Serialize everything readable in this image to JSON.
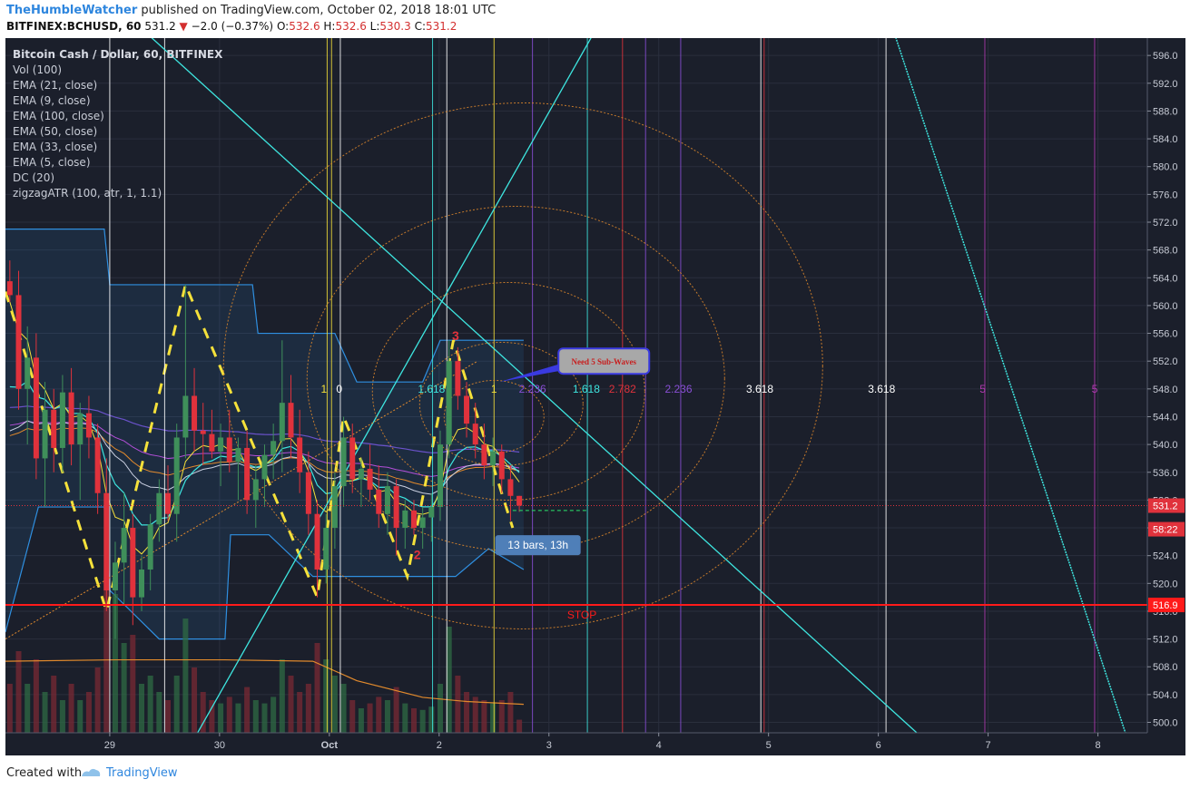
{
  "header": {
    "author": "TheHumbleWatcher",
    "published_text": "published on TradingView.com, October 02, 2018 18:01 UTC",
    "symbol_line": "BITFINEX:BCHUSD, 60",
    "last_price": "531.2",
    "change_arrow": "▼",
    "change_text": "−2.0 (−0.37%)",
    "o_label": "O:",
    "o_value": "532.6",
    "h_label": "H:",
    "h_value": "532.6",
    "l_label": "L:",
    "l_value": "530.3",
    "c_label": "C:",
    "c_value": "531.2"
  },
  "legend": {
    "title": "Bitcoin Cash / Dollar, 60, BITFINEX",
    "studies": [
      "Vol (100)",
      "EMA (21, close)",
      "EMA (9, close)",
      "EMA (100, close)",
      "EMA (50, close)",
      "EMA (33, close)",
      "EMA (5, close)",
      "DC (20)",
      "zigzagATR (100, atr, 1, 1.1)"
    ]
  },
  "footer": {
    "created_with": "Created with",
    "brand": "TradingView"
  },
  "colors": {
    "background": "#1b1f2b",
    "up": "#3f8f5a",
    "down": "#e0323c",
    "stop": "#ff1a1a",
    "cyan": "#3ee6e0",
    "yellow": "#f5e13a",
    "orange": "#e28a2c",
    "purple": "#8a4fd6",
    "blue": "#2f8fe0",
    "white": "#ffffff"
  },
  "chart_data": {
    "type": "candlestick",
    "symbol": "BITFINEX:BCHUSD",
    "interval": "60",
    "x_labels": [
      "29",
      "30",
      "Oct",
      "2",
      "3",
      "4",
      "5",
      "6",
      "7",
      "8"
    ],
    "x_ticks": [
      28.95,
      29.95,
      30.95,
      31.95,
      32.95,
      33.95,
      34.95,
      35.95,
      36.95,
      37.95
    ],
    "xlim": [
      28.0,
      38.4
    ],
    "ylim": [
      498.5,
      598.5
    ],
    "y_ticks": [
      500,
      504,
      508,
      512,
      516,
      520,
      524,
      528,
      532,
      536,
      540,
      544,
      548,
      552,
      556,
      560,
      564,
      568,
      572,
      576,
      580,
      584,
      588,
      592,
      596
    ],
    "price_tags": [
      {
        "text": "531.2",
        "value": 531.2,
        "color": "#e0323c"
      },
      {
        "text": "58:22",
        "value": 527.8,
        "color": "#e0323c"
      },
      {
        "text": "516.9",
        "value": 516.9,
        "color": "#ff1a1a"
      }
    ],
    "stop_level": 516.9,
    "stop_label": "STOP",
    "candles": [
      {
        "x": 28.04,
        "o": 563.5,
        "h": 566.5,
        "l": 560.5,
        "c": 561.5
      },
      {
        "x": 28.12,
        "o": 561.5,
        "h": 565.0,
        "l": 545.0,
        "c": 548.0
      },
      {
        "x": 28.2,
        "o": 548.0,
        "h": 557.0,
        "l": 540.0,
        "c": 552.5
      },
      {
        "x": 28.28,
        "o": 552.5,
        "h": 556.0,
        "l": 535.0,
        "c": 538.0
      },
      {
        "x": 28.36,
        "o": 538.0,
        "h": 549.0,
        "l": 531.0,
        "c": 545.0
      },
      {
        "x": 28.44,
        "o": 545.0,
        "h": 548.0,
        "l": 536.0,
        "c": 539.5
      },
      {
        "x": 28.52,
        "o": 539.5,
        "h": 550.0,
        "l": 536.0,
        "c": 547.5
      },
      {
        "x": 28.6,
        "o": 547.5,
        "h": 551.0,
        "l": 537.0,
        "c": 540.0
      },
      {
        "x": 28.68,
        "o": 540.0,
        "h": 546.0,
        "l": 532.0,
        "c": 544.5
      },
      {
        "x": 28.76,
        "o": 544.5,
        "h": 547.0,
        "l": 538.0,
        "c": 541.0
      },
      {
        "x": 28.84,
        "o": 541.0,
        "h": 543.0,
        "l": 530.0,
        "c": 533.0
      },
      {
        "x": 28.92,
        "o": 533.0,
        "h": 538.0,
        "l": 516.0,
        "c": 519.0
      },
      {
        "x": 29.0,
        "o": 519.0,
        "h": 526.0,
        "l": 512.0,
        "c": 523.0
      },
      {
        "x": 29.08,
        "o": 523.0,
        "h": 533.0,
        "l": 517.0,
        "c": 528.0
      },
      {
        "x": 29.16,
        "o": 528.0,
        "h": 530.0,
        "l": 514.0,
        "c": 518.0
      },
      {
        "x": 29.24,
        "o": 518.0,
        "h": 524.0,
        "l": 516.0,
        "c": 522.0
      },
      {
        "x": 29.32,
        "o": 522.0,
        "h": 530.0,
        "l": 519.0,
        "c": 528.5
      },
      {
        "x": 29.4,
        "o": 528.5,
        "h": 535.0,
        "l": 526.0,
        "c": 533.0
      },
      {
        "x": 29.48,
        "o": 533.0,
        "h": 537.0,
        "l": 529.0,
        "c": 530.0
      },
      {
        "x": 29.56,
        "o": 530.0,
        "h": 543.0,
        "l": 526.0,
        "c": 541.0
      },
      {
        "x": 29.64,
        "o": 541.0,
        "h": 563.0,
        "l": 538.0,
        "c": 547.0
      },
      {
        "x": 29.72,
        "o": 547.0,
        "h": 551.0,
        "l": 539.0,
        "c": 542.0
      },
      {
        "x": 29.8,
        "o": 542.0,
        "h": 546.0,
        "l": 537.0,
        "c": 541.5
      },
      {
        "x": 29.88,
        "o": 541.5,
        "h": 545.0,
        "l": 538.0,
        "c": 539.0
      },
      {
        "x": 29.96,
        "o": 539.0,
        "h": 543.0,
        "l": 534.0,
        "c": 541.0
      },
      {
        "x": 30.04,
        "o": 541.0,
        "h": 545.0,
        "l": 536.0,
        "c": 537.5
      },
      {
        "x": 30.12,
        "o": 537.5,
        "h": 541.0,
        "l": 532.0,
        "c": 539.5
      },
      {
        "x": 30.2,
        "o": 539.5,
        "h": 542.0,
        "l": 530.0,
        "c": 532.0
      },
      {
        "x": 30.28,
        "o": 532.0,
        "h": 537.0,
        "l": 528.0,
        "c": 535.0
      },
      {
        "x": 30.36,
        "o": 535.0,
        "h": 540.0,
        "l": 531.0,
        "c": 538.5
      },
      {
        "x": 30.44,
        "o": 538.5,
        "h": 543.0,
        "l": 535.0,
        "c": 540.5
      },
      {
        "x": 30.52,
        "o": 540.5,
        "h": 555.0,
        "l": 536.0,
        "c": 546.0
      },
      {
        "x": 30.6,
        "o": 546.0,
        "h": 550.0,
        "l": 538.0,
        "c": 541.0
      },
      {
        "x": 30.68,
        "o": 541.0,
        "h": 545.0,
        "l": 533.0,
        "c": 536.0
      },
      {
        "x": 30.76,
        "o": 536.0,
        "h": 539.0,
        "l": 527.0,
        "c": 530.0
      },
      {
        "x": 30.84,
        "o": 530.0,
        "h": 532.0,
        "l": 518.0,
        "c": 522.0
      },
      {
        "x": 30.92,
        "o": 522.0,
        "h": 530.0,
        "l": 520.0,
        "c": 528.0
      },
      {
        "x": 31.0,
        "o": 528.0,
        "h": 536.0,
        "l": 525.0,
        "c": 534.0
      },
      {
        "x": 31.08,
        "o": 534.0,
        "h": 544.0,
        "l": 531.0,
        "c": 541.0
      },
      {
        "x": 31.16,
        "o": 541.0,
        "h": 543.0,
        "l": 533.0,
        "c": 535.0
      },
      {
        "x": 31.24,
        "o": 535.0,
        "h": 538.0,
        "l": 531.0,
        "c": 536.5
      },
      {
        "x": 31.32,
        "o": 536.5,
        "h": 540.0,
        "l": 532.0,
        "c": 533.5
      },
      {
        "x": 31.4,
        "o": 533.5,
        "h": 537.0,
        "l": 528.0,
        "c": 530.0
      },
      {
        "x": 31.48,
        "o": 530.0,
        "h": 536.0,
        "l": 527.0,
        "c": 534.0
      },
      {
        "x": 31.56,
        "o": 534.0,
        "h": 535.0,
        "l": 524.0,
        "c": 528.0
      },
      {
        "x": 31.64,
        "o": 528.0,
        "h": 532.0,
        "l": 525.0,
        "c": 530.5
      },
      {
        "x": 31.72,
        "o": 530.5,
        "h": 532.0,
        "l": 527.0,
        "c": 528.0
      },
      {
        "x": 31.8,
        "o": 528.0,
        "h": 531.0,
        "l": 525.0,
        "c": 529.5
      },
      {
        "x": 31.88,
        "o": 529.5,
        "h": 533.0,
        "l": 526.0,
        "c": 531.0
      },
      {
        "x": 31.96,
        "o": 531.0,
        "h": 542.0,
        "l": 529.0,
        "c": 540.0
      },
      {
        "x": 32.04,
        "o": 540.0,
        "h": 555.0,
        "l": 538.0,
        "c": 552.0
      },
      {
        "x": 32.12,
        "o": 552.0,
        "h": 554.0,
        "l": 545.0,
        "c": 547.0
      },
      {
        "x": 32.2,
        "o": 547.0,
        "h": 549.0,
        "l": 541.0,
        "c": 543.0
      },
      {
        "x": 32.28,
        "o": 543.0,
        "h": 546.0,
        "l": 538.0,
        "c": 540.0
      },
      {
        "x": 32.36,
        "o": 540.0,
        "h": 543.0,
        "l": 535.0,
        "c": 537.0
      },
      {
        "x": 32.44,
        "o": 537.0,
        "h": 541.0,
        "l": 534.0,
        "c": 539.0
      },
      {
        "x": 32.52,
        "o": 539.0,
        "h": 540.0,
        "l": 533.0,
        "c": 535.0
      },
      {
        "x": 32.6,
        "o": 535.0,
        "h": 537.0,
        "l": 529.0,
        "c": 532.6
      },
      {
        "x": 32.68,
        "o": 532.6,
        "h": 532.6,
        "l": 530.3,
        "c": 531.2
      }
    ],
    "volume": [
      {
        "x": 28.04,
        "v": 0.3
      },
      {
        "x": 28.12,
        "v": 0.5
      },
      {
        "x": 28.2,
        "v": 0.3
      },
      {
        "x": 28.28,
        "v": 0.45
      },
      {
        "x": 28.36,
        "v": 0.25
      },
      {
        "x": 28.44,
        "v": 0.35
      },
      {
        "x": 28.52,
        "v": 0.2
      },
      {
        "x": 28.6,
        "v": 0.3
      },
      {
        "x": 28.68,
        "v": 0.2
      },
      {
        "x": 28.76,
        "v": 0.25
      },
      {
        "x": 28.84,
        "v": 0.4
      },
      {
        "x": 28.92,
        "v": 0.95
      },
      {
        "x": 29.0,
        "v": 0.85
      },
      {
        "x": 29.08,
        "v": 0.55
      },
      {
        "x": 29.16,
        "v": 0.6
      },
      {
        "x": 29.24,
        "v": 0.3
      },
      {
        "x": 29.32,
        "v": 0.35
      },
      {
        "x": 29.4,
        "v": 0.25
      },
      {
        "x": 29.48,
        "v": 0.2
      },
      {
        "x": 29.56,
        "v": 0.35
      },
      {
        "x": 29.64,
        "v": 0.7
      },
      {
        "x": 29.72,
        "v": 0.4
      },
      {
        "x": 29.8,
        "v": 0.25
      },
      {
        "x": 29.88,
        "v": 0.2
      },
      {
        "x": 29.96,
        "v": 0.18
      },
      {
        "x": 30.04,
        "v": 0.22
      },
      {
        "x": 30.12,
        "v": 0.18
      },
      {
        "x": 30.2,
        "v": 0.28
      },
      {
        "x": 30.28,
        "v": 0.2
      },
      {
        "x": 30.36,
        "v": 0.18
      },
      {
        "x": 30.44,
        "v": 0.22
      },
      {
        "x": 30.52,
        "v": 0.45
      },
      {
        "x": 30.6,
        "v": 0.35
      },
      {
        "x": 30.68,
        "v": 0.25
      },
      {
        "x": 30.76,
        "v": 0.3
      },
      {
        "x": 30.84,
        "v": 0.55
      },
      {
        "x": 30.92,
        "v": 0.45
      },
      {
        "x": 31.0,
        "v": 0.35
      },
      {
        "x": 31.08,
        "v": 0.3
      },
      {
        "x": 31.16,
        "v": 0.2
      },
      {
        "x": 31.24,
        "v": 0.15
      },
      {
        "x": 31.32,
        "v": 0.18
      },
      {
        "x": 31.4,
        "v": 0.22
      },
      {
        "x": 31.48,
        "v": 0.2
      },
      {
        "x": 31.56,
        "v": 0.28
      },
      {
        "x": 31.64,
        "v": 0.18
      },
      {
        "x": 31.72,
        "v": 0.15
      },
      {
        "x": 31.8,
        "v": 0.14
      },
      {
        "x": 31.88,
        "v": 0.16
      },
      {
        "x": 31.96,
        "v": 0.3
      },
      {
        "x": 32.04,
        "v": 0.65
      },
      {
        "x": 32.12,
        "v": 0.35
      },
      {
        "x": 32.2,
        "v": 0.25
      },
      {
        "x": 32.28,
        "v": 0.22
      },
      {
        "x": 32.36,
        "v": 0.2
      },
      {
        "x": 32.44,
        "v": 0.18
      },
      {
        "x": 32.52,
        "v": 0.2
      },
      {
        "x": 32.6,
        "v": 0.25
      },
      {
        "x": 32.68,
        "v": 0.08
      }
    ],
    "fib_labels": [
      {
        "text": "1",
        "x": 30.9,
        "y": 548.0,
        "color": "#f5e13a"
      },
      {
        "text": "0",
        "x": 31.04,
        "y": 548.0,
        "color": "#ffffff"
      },
      {
        "text": "1.618",
        "x": 31.88,
        "y": 548.0,
        "color": "#3ee6e0"
      },
      {
        "text": "1",
        "x": 32.45,
        "y": 548.0,
        "color": "#f5e13a"
      },
      {
        "text": "2.236",
        "x": 32.8,
        "y": 548.0,
        "color": "#8a4fd6"
      },
      {
        "text": "1.618",
        "x": 33.29,
        "y": 548.0,
        "color": "#3ee6e0"
      },
      {
        "text": "2.782",
        "x": 33.62,
        "y": 548.0,
        "color": "#e0323c"
      },
      {
        "text": "2.236",
        "x": 34.13,
        "y": 548.0,
        "color": "#8a4fd6"
      },
      {
        "text": "3.618",
        "x": 34.87,
        "y": 548.0,
        "color": "#ffffff"
      },
      {
        "text": "3.618",
        "x": 35.98,
        "y": 548.0,
        "color": "#ffffff"
      },
      {
        "text": "5",
        "x": 36.9,
        "y": 548.0,
        "color": "#b03ab0"
      },
      {
        "text": "5",
        "x": 37.92,
        "y": 548.0,
        "color": "#b03ab0"
      }
    ],
    "wave_labels": [
      {
        "text": "3",
        "x": 32.1,
        "y": 555.0,
        "color": "#e0323c"
      },
      {
        "text": "2",
        "x": 31.75,
        "y": 523.5,
        "color": "#e0323c"
      }
    ],
    "annotation_callout": {
      "text": "Need 5 Sub-Waves",
      "x": 33.45,
      "y": 552.0
    },
    "bars_label": {
      "text": "13 bars, 13h",
      "x": 32.85,
      "y": 525.5
    }
  }
}
